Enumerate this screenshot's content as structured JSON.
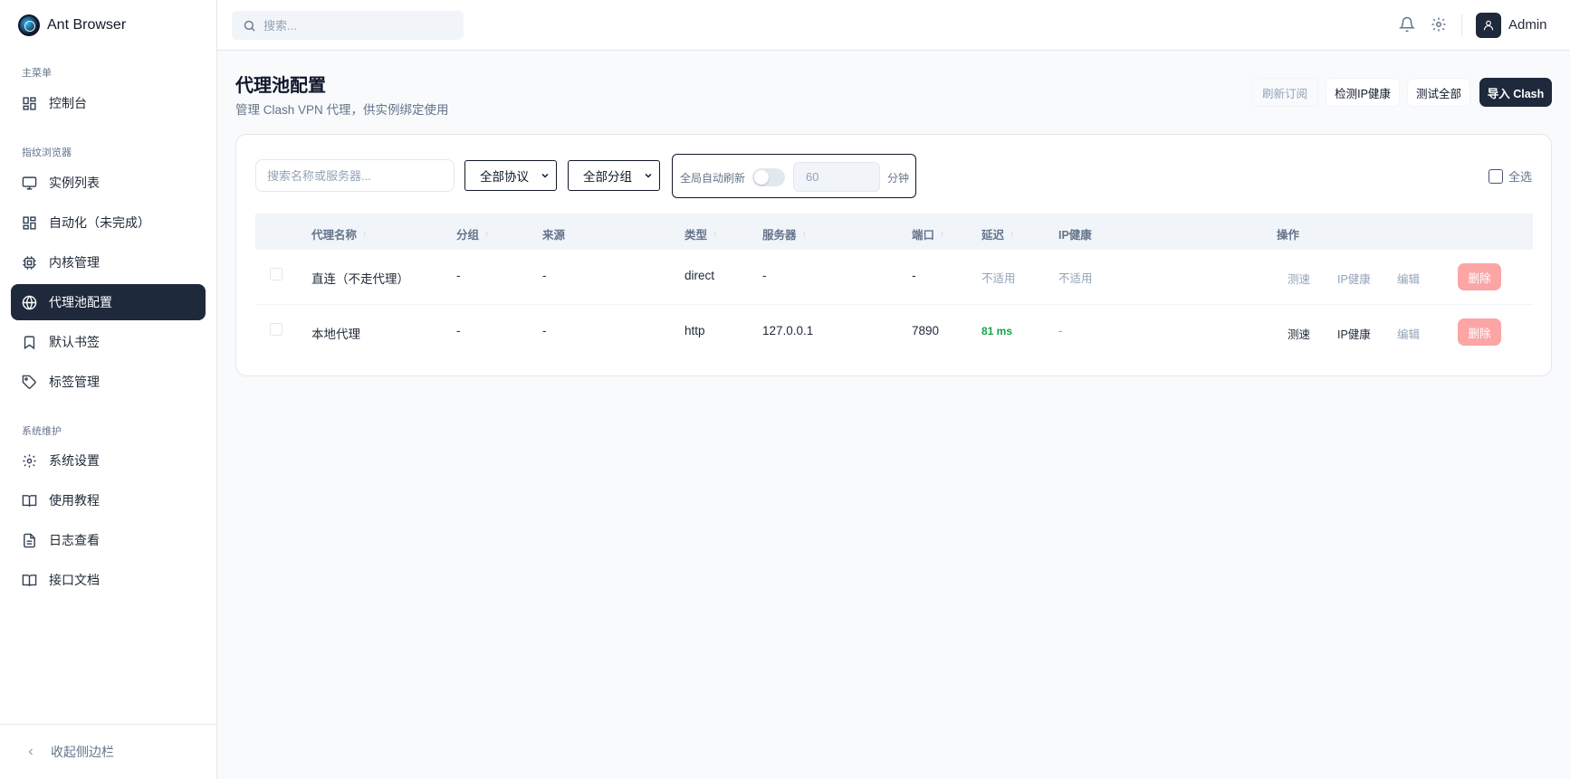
{
  "brand": {
    "name": "Ant Browser"
  },
  "sidebar": {
    "sections": [
      {
        "label": "主菜单"
      },
      {
        "label": "指纹浏览器"
      },
      {
        "label": "系统维护"
      }
    ],
    "items": [
      {
        "label": "控制台",
        "icon": "dashboard-icon"
      },
      {
        "label": "实例列表",
        "icon": "monitor-icon"
      },
      {
        "label": "自动化（未完成）",
        "icon": "grid-icon"
      },
      {
        "label": "内核管理",
        "icon": "cpu-icon"
      },
      {
        "label": "代理池配置",
        "icon": "globe-icon",
        "active": true
      },
      {
        "label": "默认书签",
        "icon": "bookmark-icon"
      },
      {
        "label": "标签管理",
        "icon": "tag-icon"
      },
      {
        "label": "系统设置",
        "icon": "gear-icon"
      },
      {
        "label": "使用教程",
        "icon": "book-icon"
      },
      {
        "label": "日志查看",
        "icon": "file-icon"
      },
      {
        "label": "接口文档",
        "icon": "book-icon"
      }
    ],
    "collapse_label": "收起侧边栏"
  },
  "header": {
    "search_placeholder": "搜索...",
    "user_name": "Admin"
  },
  "page": {
    "title": "代理池配置",
    "subtitle": "管理 Clash VPN 代理，供实例绑定使用",
    "buttons": {
      "refresh": "刷新订阅",
      "check_ip": "检测IP健康",
      "test_all": "测试全部",
      "import": "导入 Clash"
    }
  },
  "filters": {
    "search_placeholder": "搜索名称或服务器...",
    "protocol": "全部协议",
    "group": "全部分组",
    "auto_refresh_label": "全局自动刷新",
    "auto_refresh_enabled": false,
    "minutes_value": "60",
    "minutes_unit": "分钟",
    "select_all": "全选"
  },
  "table": {
    "columns": {
      "name": "代理名称",
      "group": "分组",
      "source": "来源",
      "type": "类型",
      "server": "服务器",
      "port": "端口",
      "latency": "延迟",
      "ip_health": "IP健康",
      "actions": "操作"
    },
    "sort_arrow": "↑",
    "rows": [
      {
        "name": "直连（不走代理）",
        "group": "-",
        "source": "-",
        "type": "direct",
        "server": "-",
        "port": "-",
        "latency": "不适用",
        "ip_health": "不适用"
      },
      {
        "name": "本地代理",
        "group": "-",
        "source": "-",
        "type": "http",
        "server": "127.0.0.1",
        "port": "7890",
        "latency": "81 ms",
        "ip_health": "-"
      }
    ],
    "actions": {
      "speed": "测速",
      "ip_health": "IP健康",
      "edit": "编辑",
      "delete": "删除"
    }
  },
  "colors": {
    "primary": "#1e293b",
    "danger_soft": "#fca5a5",
    "success": "#16a34a"
  }
}
